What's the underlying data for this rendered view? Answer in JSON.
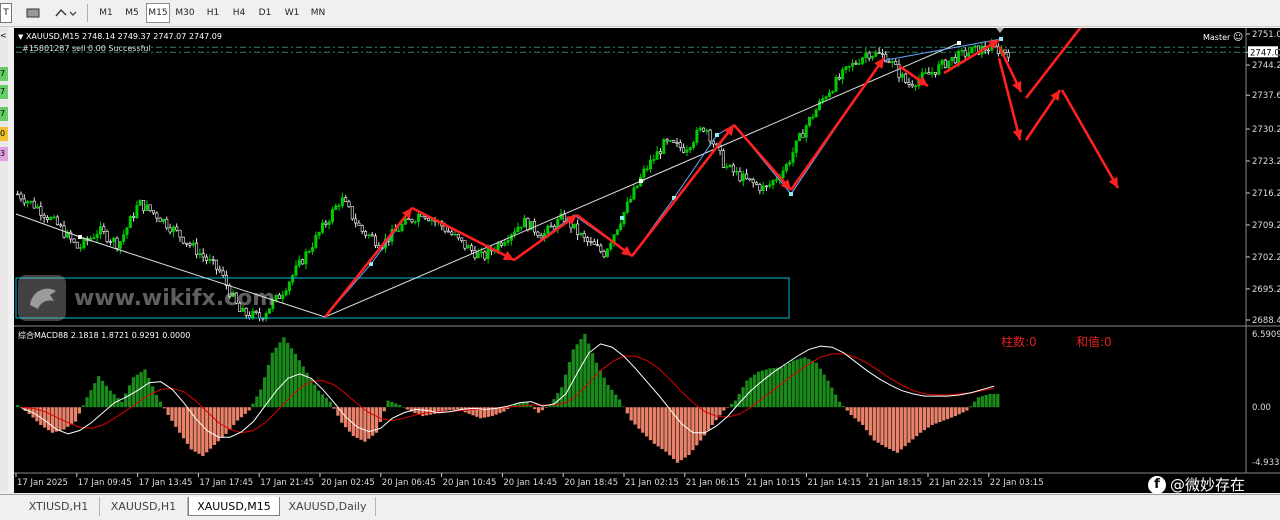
{
  "toolbar": {
    "left_icons": [
      "terminal-icon",
      "chart-template-icon",
      "objects-icon"
    ],
    "left_label_T": "T",
    "timeframes": [
      "M1",
      "M5",
      "M15",
      "M30",
      "H1",
      "H4",
      "D1",
      "W1",
      "MN"
    ],
    "active_timeframe": "M15"
  },
  "left_strip": [
    {
      "text": "<",
      "color": "#e8e8e8"
    },
    {
      "text": "7",
      "color": "#66cc66"
    },
    {
      "text": "7",
      "color": "#66cc66"
    },
    {
      "text": "7",
      "color": "#66cc66"
    },
    {
      "text": "0",
      "color": "#f0c030"
    },
    {
      "text": "3",
      "color": "#e0a0e0"
    }
  ],
  "chart_header": {
    "symbol_line": "XAUUSD,M15  2748.14 2749.37 2747.07 2747.09",
    "status_line": "#15801287 sell 0.00 Successful",
    "master_label": "Master"
  },
  "macd_header": "综合MACD88 2.1818 1.8721 0.9291 0.0000",
  "macd_labels": {
    "bars": "柱数:0",
    "sum": "和值:0"
  },
  "colors": {
    "background": "#000000",
    "bull": "#00cc00",
    "bear": "#ffffff",
    "trend_arrow": "#ff2020",
    "box": "#00bcd4",
    "macd_pos": "#1a8a1a",
    "macd_neg": "#e8826a",
    "signal": "#e00000",
    "macd_line": "#ffffff"
  },
  "chart_data": [
    {
      "type": "candlestick",
      "title": "XAUUSD,M15",
      "y_axis_ticks": [
        "2751.0",
        "2747.0",
        "2744.2",
        "2737.6",
        "2730.2",
        "2723.2",
        "2716.2",
        "2709.2",
        "2702.2",
        "2695.2",
        "2688.4"
      ],
      "ylim": [
        2688.4,
        2751.0
      ],
      "current_price": "2747.0",
      "x_axis_ticks": [
        "17 Jan 2025",
        "17 Jan 09:45",
        "17 Jan 13:45",
        "17 Jan 17:45",
        "17 Jan 21:45",
        "20 Jan 02:45",
        "20 Jan 06:45",
        "20 Jan 10:45",
        "20 Jan 14:45",
        "20 Jan 18:45",
        "21 Jan 02:15",
        "21 Jan 06:15",
        "21 Jan 10:15",
        "21 Jan 14:15",
        "21 Jan 18:15",
        "21 Jan 22:15",
        "22 Jan 03:15"
      ],
      "anchor_prices": [
        2716,
        2713,
        2709,
        2704,
        2708,
        2705,
        2714,
        2711,
        2707,
        2703,
        2699,
        2690,
        2689,
        2694,
        2701,
        2708,
        2715,
        2708,
        2705,
        2709,
        2712,
        2709,
        2705,
        2702,
        2706,
        2710,
        2707,
        2711,
        2706,
        2703,
        2712,
        2721,
        2727,
        2726,
        2731,
        2722,
        2719,
        2717,
        2722,
        2731,
        2738,
        2743,
        2747,
        2746,
        2740,
        2742,
        2745,
        2747,
        2748,
        2747.1
      ]
    },
    {
      "type": "bar",
      "title": "综合MACD88",
      "y_axis_ticks": [
        "6.5909",
        "0.00",
        "-4.933"
      ],
      "ylim": [
        -4.933,
        6.5909
      ],
      "values": [
        0.2,
        -0.6,
        -1.6,
        -2.3,
        -2.0,
        -1.3,
        0.9,
        2.8,
        1.5,
        0.5,
        2.7,
        3.4,
        1.1,
        -0.7,
        -2.3,
        -3.8,
        -4.4,
        -3.4,
        -2.4,
        -1.2,
        -0.3,
        1.6,
        4.9,
        6.3,
        4.8,
        3.1,
        1.5,
        0.5,
        -1.4,
        -2.6,
        -3.1,
        -2.3,
        0.6,
        0.2,
        -0.4,
        -0.8,
        -0.6,
        -0.3,
        -0.2,
        -0.6,
        -1.0,
        -0.8,
        -0.4,
        0.3,
        0.5,
        -0.5,
        0.2,
        1.8,
        5.2,
        6.6,
        4.0,
        2.0,
        0.7,
        -1.2,
        -2.3,
        -3.3,
        -4.0,
        -5.0,
        -4.3,
        -3.0,
        -1.6,
        -0.3,
        0.6,
        2.4,
        3.2,
        3.5,
        3.6,
        4.2,
        4.5,
        4.0,
        2.4,
        0.5,
        -0.7,
        -1.6,
        -3.0,
        -3.6,
        -4.1,
        -3.2,
        -2.3,
        -1.6,
        -1.2,
        -0.8,
        -0.3,
        0.9,
        1.2
      ],
      "macd_line": [
        -0.1,
        -0.5,
        -1.2,
        -2.0,
        -2.4,
        -2.1,
        -1.4,
        -0.5,
        0.4,
        0.9,
        1.5,
        2.2,
        2.3,
        1.6,
        0.4,
        -1.0,
        -2.1,
        -2.7,
        -2.7,
        -2.2,
        -1.3,
        0.1,
        1.5,
        2.6,
        3.0,
        2.6,
        1.6,
        0.4,
        -0.9,
        -1.8,
        -2.2,
        -1.9,
        -1.0,
        -0.5,
        -0.2,
        -0.3,
        -0.5,
        -0.4,
        -0.2,
        -0.1,
        -0.2,
        -0.1,
        0.1,
        0.4,
        0.5,
        0.1,
        0.3,
        1.2,
        3.1,
        4.9,
        5.7,
        5.4,
        4.6,
        3.5,
        2.3,
        1.1,
        -0.2,
        -1.5,
        -2.3,
        -2.3,
        -1.7,
        -0.8,
        0.4,
        1.5,
        2.4,
        3.2,
        3.9,
        4.6,
        5.2,
        5.5,
        5.4,
        4.9,
        4.1,
        3.3,
        2.6,
        2.0,
        1.5,
        1.2,
        1.0,
        1.0,
        1.0,
        1.1,
        1.3,
        1.6,
        1.9
      ],
      "signal_line": [
        0.0,
        -0.1,
        -0.4,
        -0.9,
        -1.4,
        -1.8,
        -1.9,
        -1.6,
        -1.0,
        -0.3,
        0.4,
        1.1,
        1.6,
        1.7,
        1.4,
        0.6,
        -0.4,
        -1.4,
        -2.0,
        -2.3,
        -2.1,
        -1.4,
        -0.4,
        0.7,
        1.7,
        2.3,
        2.4,
        2.0,
        1.2,
        0.3,
        -0.5,
        -1.0,
        -1.2,
        -1.0,
        -0.7,
        -0.5,
        -0.4,
        -0.4,
        -0.3,
        -0.2,
        -0.2,
        -0.1,
        0.0,
        0.1,
        0.2,
        0.2,
        0.2,
        0.4,
        1.1,
        2.2,
        3.3,
        4.1,
        4.6,
        4.6,
        4.2,
        3.5,
        2.5,
        1.4,
        0.4,
        -0.4,
        -0.8,
        -0.9,
        -0.6,
        0.0,
        0.8,
        1.6,
        2.4,
        3.2,
        3.9,
        4.5,
        4.8,
        4.8,
        4.5,
        4.0,
        3.3,
        2.6,
        2.0,
        1.5,
        1.2,
        1.1,
        1.1,
        1.2,
        1.3,
        1.5,
        1.7
      ]
    }
  ],
  "tabs": [
    {
      "label": "XTIUSD,H1",
      "active": false
    },
    {
      "label": "XAUUSD,H1",
      "active": false
    },
    {
      "label": "XAUUSD,M15",
      "active": true
    },
    {
      "label": "XAUUSD,Daily",
      "active": false
    }
  ],
  "watermark": {
    "text": "www.wikifx.com"
  },
  "social": {
    "handle": "@微妙存在"
  }
}
